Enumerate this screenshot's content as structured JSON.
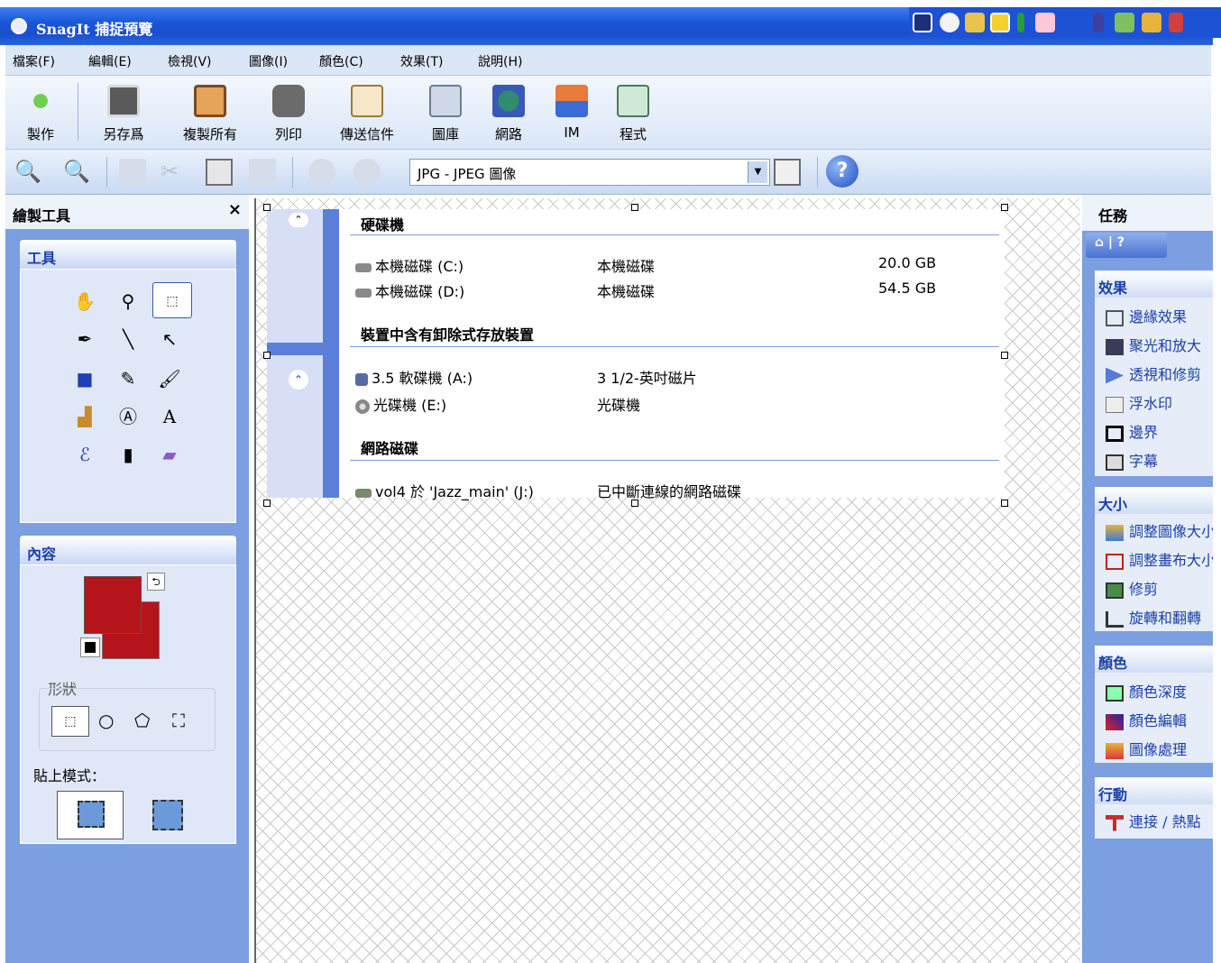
{
  "window": {
    "title": "SnagIt 捕捉預覽"
  },
  "menu": [
    "檔案(F)",
    "編輯(E)",
    "檢視(V)",
    "圖像(I)",
    "顏色(C)",
    "效果(T)",
    "說明(H)"
  ],
  "toolbar": {
    "buttons": [
      "製作",
      "另存爲",
      "複製所有",
      "列印",
      "傳送信件",
      "圖庫",
      "網路",
      "IM",
      "程式"
    ]
  },
  "format_combo": {
    "value": "JPG - JPEG 圖像"
  },
  "left_panel": {
    "title": "繪製工具",
    "close": "×",
    "tools_group": "工具",
    "content_group": "內容",
    "shape_label": "形狀",
    "paste_mode_label": "貼上模式："
  },
  "capture": {
    "section_hdd": "硬碟機",
    "section_removable": "裝置中含有卸除式存放裝置",
    "section_network": "網路磁碟",
    "rows": [
      {
        "name": "本機磁碟 (C:)",
        "type": "本機磁碟",
        "size": "20.0 GB"
      },
      {
        "name": "本機磁碟 (D:)",
        "type": "本機磁碟",
        "size": "54.5 GB"
      },
      {
        "name": "3.5 軟碟機 (A:)",
        "type": "3 1/2-英吋磁片",
        "size": ""
      },
      {
        "name": "光碟機 (E:)",
        "type": "光碟機",
        "size": ""
      },
      {
        "name": "vol4 於 'Jazz_main' (J:)",
        "type": "已中斷連線的網路磁碟",
        "size": ""
      }
    ]
  },
  "right_panel": {
    "title": "任務",
    "groups": [
      {
        "title": "效果",
        "items": [
          "邊緣效果",
          "聚光和放大",
          "透視和修剪",
          "浮水印",
          "邊界",
          "字幕"
        ]
      },
      {
        "title": "大小",
        "items": [
          "調整圖像大小",
          "調整畫布大小",
          "修剪",
          "旋轉和翻轉"
        ]
      },
      {
        "title": "顏色",
        "items": [
          "顏色深度",
          "顏色編輯",
          "圖像處理"
        ]
      },
      {
        "title": "行動",
        "items": [
          "連接 / 熱點"
        ]
      }
    ]
  },
  "colors": {
    "foreground": "#b5141a",
    "background": "#b5141a"
  }
}
